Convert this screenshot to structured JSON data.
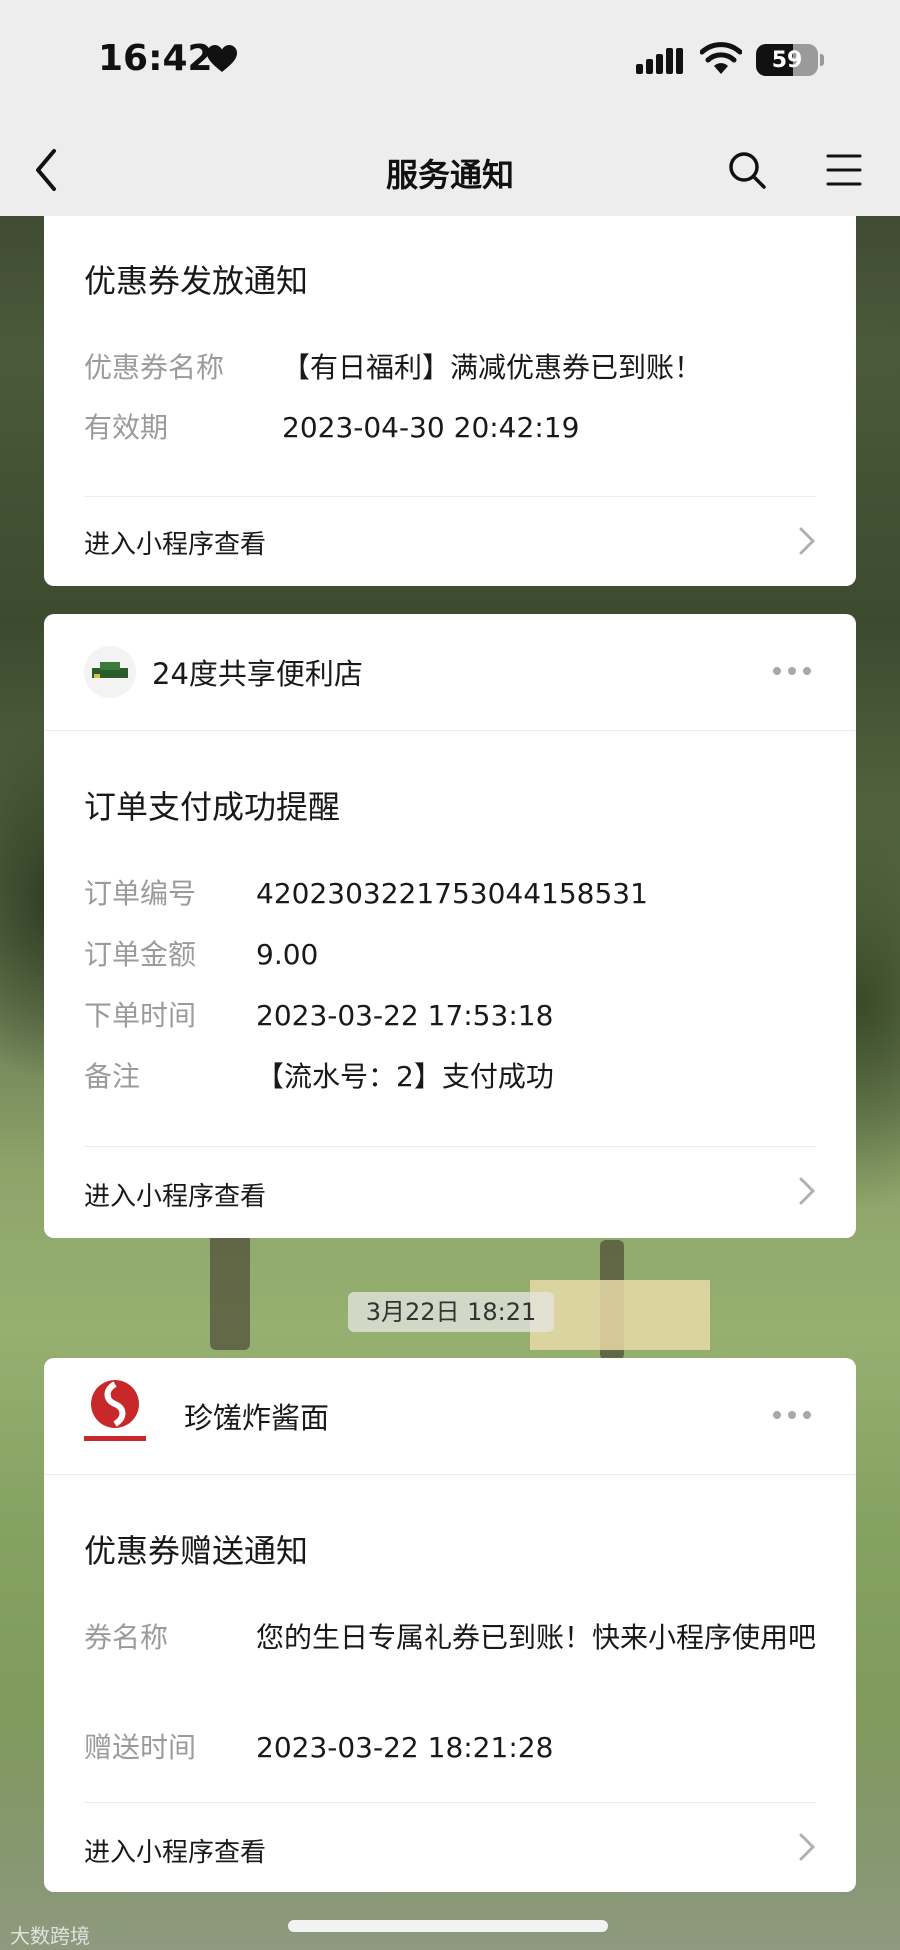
{
  "status_bar": {
    "time": "16:42",
    "battery": "59",
    "battery_level": 0.59
  },
  "nav": {
    "title": "服务通知"
  },
  "cards": [
    {
      "title": "优惠券发放通知",
      "fields": [
        {
          "key": "优惠券名称",
          "value": "【有日福利】满减优惠券已到账！"
        },
        {
          "key": "有效期",
          "value": "2023-04-30 20:42:19"
        }
      ],
      "link": "进入小程序查看"
    },
    {
      "name": "24度共享便利店",
      "title": "订单支付成功提醒",
      "fields": [
        {
          "key": "订单编号",
          "value": "4202303221753044158531"
        },
        {
          "key": "订单金额",
          "value": "9.00"
        },
        {
          "key": "下单时间",
          "value": "2023-03-22 17:53:18"
        },
        {
          "key": "备注",
          "value": "【流水号：2】支付成功"
        }
      ],
      "link": "进入小程序查看"
    },
    {
      "name": "珍馐炸酱面",
      "title": "优惠券赠送通知",
      "fields": [
        {
          "key": "券名称",
          "value": "您的生日专属礼券已到账！快来小程序使用吧"
        },
        {
          "key": "赠送时间",
          "value": "2023-03-22 18:21:28"
        }
      ],
      "link": "进入小程序查看"
    }
  ],
  "timestamp_pill": "3月22日 18:21",
  "watermark": "大数跨境"
}
